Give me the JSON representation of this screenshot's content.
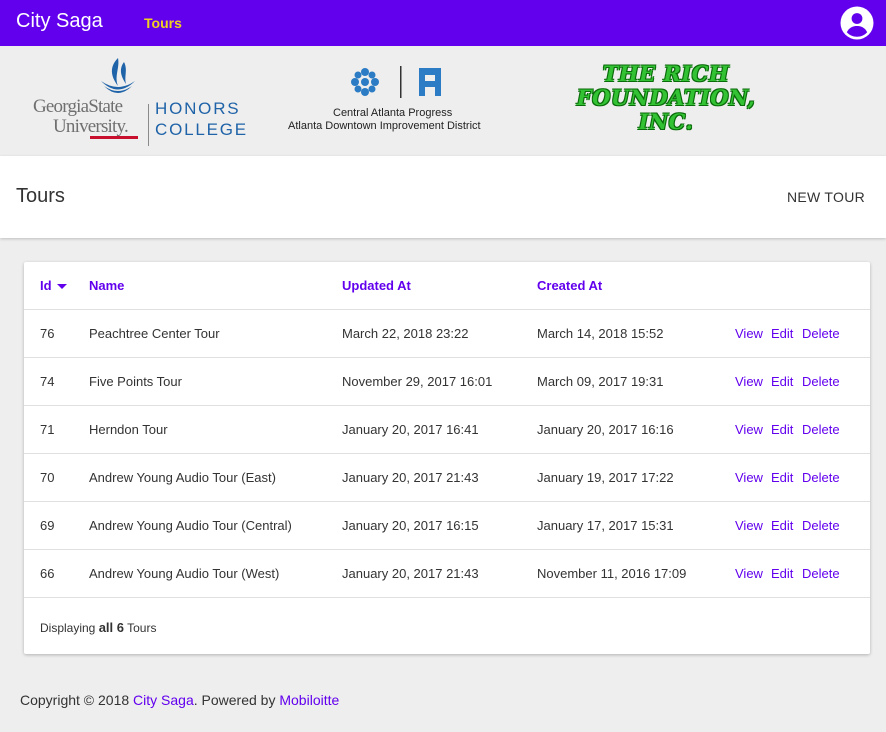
{
  "header": {
    "brand": "City Saga",
    "nav_tours": "Tours",
    "account_icon": "account-circle-icon",
    "colors": {
      "bar": "#6200ee",
      "nav_active": "#f0d020"
    }
  },
  "sponsors": {
    "gsu": {
      "line1": "GeorgiaState",
      "line2": "University.",
      "honors": "HONORS",
      "college": "COLLEGE"
    },
    "cap": {
      "line1": "Central Atlanta Progress",
      "line2": "Atlanta Downtown Improvement District"
    },
    "rich": {
      "line1": "THE RICH",
      "line2": "FOUNDATION,",
      "line3": "INC."
    }
  },
  "toolbar": {
    "title": "Tours",
    "new_button": "NEW TOUR"
  },
  "table": {
    "columns": {
      "id": "Id",
      "name": "Name",
      "updated": "Updated At",
      "created": "Created At"
    },
    "sort_icon": "sort-down-icon",
    "actions": {
      "view": "View",
      "edit": "Edit",
      "delete": "Delete"
    },
    "rows": [
      {
        "id": "76",
        "name": "Peachtree Center Tour",
        "updated": "March 22, 2018 23:22",
        "created": "March 14, 2018 15:52"
      },
      {
        "id": "74",
        "name": "Five Points Tour",
        "updated": "November 29, 2017 16:01",
        "created": "March 09, 2017 19:31"
      },
      {
        "id": "71",
        "name": "Herndon Tour",
        "updated": "January 20, 2017 16:41",
        "created": "January 20, 2017 16:16"
      },
      {
        "id": "70",
        "name": "Andrew Young Audio Tour (East)",
        "updated": "January 20, 2017 21:43",
        "created": "January 19, 2017 17:22"
      },
      {
        "id": "69",
        "name": "Andrew Young Audio Tour (Central)",
        "updated": "January 20, 2017 16:15",
        "created": "January 17, 2017 15:31"
      },
      {
        "id": "66",
        "name": "Andrew Young Audio Tour (West)",
        "updated": "January 20, 2017 21:43",
        "created": "November 11, 2016 17:09"
      }
    ],
    "footer": {
      "prefix": "Displaying",
      "count": "all 6",
      "suffix": "Tours"
    }
  },
  "footer": {
    "prefix": "Copyright © 2018",
    "link1": "City Saga",
    "middle": ". Powered by",
    "link2": "Mobiloitte"
  }
}
